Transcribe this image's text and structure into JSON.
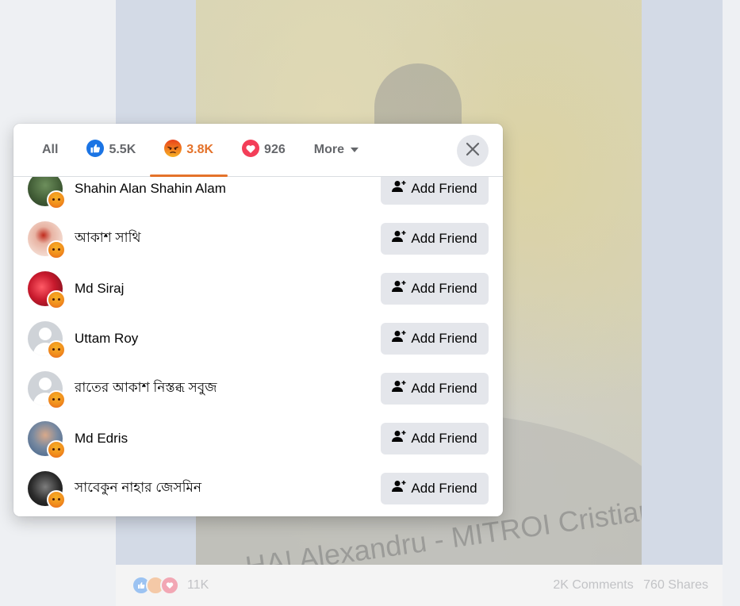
{
  "dialog": {
    "tabs": [
      {
        "label": "All",
        "icon": "none"
      },
      {
        "label": "5.5K",
        "icon": "like-icon"
      },
      {
        "label": "3.8K",
        "icon": "angry-icon",
        "active": true
      },
      {
        "label": "926",
        "icon": "love-icon"
      },
      {
        "label": "More",
        "icon": "caret-down-icon"
      }
    ],
    "close_icon": "close-icon",
    "accent_color": "#e4722a",
    "people": [
      {
        "name": "Shahin Alan Shahin Alam",
        "button": "Add Friend",
        "avatar": "photo"
      },
      {
        "name": "আকাশ সাথি",
        "button": "Add Friend",
        "avatar": "photo"
      },
      {
        "name": "Md Siraj",
        "button": "Add Friend",
        "avatar": "photo"
      },
      {
        "name": "Uttam Roy",
        "button": "Add Friend",
        "avatar": "default"
      },
      {
        "name": "রাতের আকাশ নিস্তব্ধ সবুজ",
        "button": "Add Friend",
        "avatar": "default"
      },
      {
        "name": "Md Edris",
        "button": "Add Friend",
        "avatar": "photo"
      },
      {
        "name": "সাবেকুন নাহার জেসমিন",
        "button": "Add Friend",
        "avatar": "photo"
      }
    ]
  },
  "post": {
    "reaction_count": "11K",
    "comments": "2K Comments",
    "shares": "760 Shares",
    "photo_text": "HA! Alexandru - MITROI Cristian-N"
  }
}
